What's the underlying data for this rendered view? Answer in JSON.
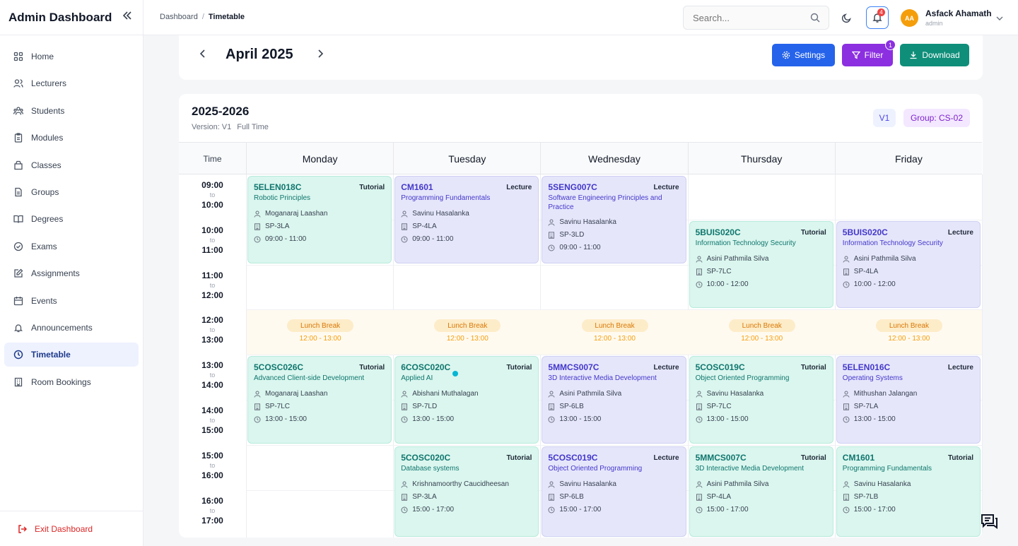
{
  "sidebar": {
    "title": "Admin Dashboard",
    "items": [
      {
        "label": "Home",
        "icon": "grid-icon"
      },
      {
        "label": "Lecturers",
        "icon": "users-icon"
      },
      {
        "label": "Students",
        "icon": "students-icon"
      },
      {
        "label": "Modules",
        "icon": "clipboard-icon"
      },
      {
        "label": "Classes",
        "icon": "classes-icon"
      },
      {
        "label": "Groups",
        "icon": "file-icon"
      },
      {
        "label": "Degrees",
        "icon": "book-icon"
      },
      {
        "label": "Exams",
        "icon": "check-circle-icon"
      },
      {
        "label": "Assignments",
        "icon": "edit-icon"
      },
      {
        "label": "Events",
        "icon": "calendar-icon"
      },
      {
        "label": "Announcements",
        "icon": "bell-icon"
      },
      {
        "label": "Timetable",
        "icon": "clock-icon"
      },
      {
        "label": "Room Bookings",
        "icon": "building-icon"
      }
    ],
    "active": "Timetable",
    "exit_label": "Exit Dashboard"
  },
  "header": {
    "breadcrumb": [
      "Dashboard",
      "Timetable"
    ],
    "search_placeholder": "Search...",
    "notification_count": "4",
    "user": {
      "initials": "AA",
      "name": "Asfack Ahamath",
      "role": "admin"
    }
  },
  "month": {
    "title": "April 2025",
    "settings_label": "Settings",
    "filter_label": "Filter",
    "filter_count": "1",
    "download_label": "Download"
  },
  "timetable": {
    "year": "2025-2026",
    "version": "Version: V1",
    "mode": "Full Time",
    "version_tag": "V1",
    "group_tag": "Group: CS-02",
    "time_header": "Time",
    "days": [
      "Monday",
      "Tuesday",
      "Wednesday",
      "Thursday",
      "Friday"
    ],
    "slots": [
      {
        "start": "09:00",
        "to": "to",
        "end": "10:00"
      },
      {
        "start": "10:00",
        "to": "to",
        "end": "11:00"
      },
      {
        "start": "11:00",
        "to": "to",
        "end": "12:00"
      },
      {
        "start": "12:00",
        "to": "to",
        "end": "13:00"
      },
      {
        "start": "13:00",
        "to": "to",
        "end": "14:00"
      },
      {
        "start": "14:00",
        "to": "to",
        "end": "15:00"
      },
      {
        "start": "15:00",
        "to": "to",
        "end": "16:00"
      },
      {
        "start": "16:00",
        "to": "to",
        "end": "17:00"
      }
    ],
    "lunch": {
      "label": "Lunch Break",
      "time": "12:00 - 13:00"
    },
    "events": [
      {
        "day": 0,
        "slot": 0,
        "span": 2,
        "code": "5ELEN018C",
        "kind": "Tutorial",
        "name": "Robotic Principles",
        "lecturer": "Moganaraj Laashan",
        "room": "SP-3LA",
        "time": "09:00 - 11:00"
      },
      {
        "day": 1,
        "slot": 0,
        "span": 2,
        "code": "CM1601",
        "kind": "Lecture",
        "name": "Programming Fundamentals",
        "lecturer": "Savinu Hasalanka",
        "room": "SP-4LA",
        "time": "09:00 - 11:00"
      },
      {
        "day": 2,
        "slot": 0,
        "span": 2,
        "code": "5SENG007C",
        "kind": "Lecture",
        "name": "Software Engineering Principles and Practice",
        "lecturer": "Savinu Hasalanka",
        "room": "SP-3LD",
        "time": "09:00 - 11:00"
      },
      {
        "day": 3,
        "slot": 1,
        "span": 2,
        "code": "5BUIS020C",
        "kind": "Tutorial",
        "name": "Information Technology Security",
        "lecturer": "Asini Pathmila Silva",
        "room": "SP-7LC",
        "time": "10:00 - 12:00"
      },
      {
        "day": 4,
        "slot": 1,
        "span": 2,
        "code": "5BUIS020C",
        "kind": "Lecture",
        "name": "Information Technology Security",
        "lecturer": "Asini Pathmila Silva",
        "room": "SP-4LA",
        "time": "10:00 - 12:00"
      },
      {
        "day": 0,
        "slot": 4,
        "span": 2,
        "code": "5COSC026C",
        "kind": "Tutorial",
        "name": "Advanced Client-side Development",
        "lecturer": "Moganaraj Laashan",
        "room": "SP-7LC",
        "time": "13:00 - 15:00"
      },
      {
        "day": 1,
        "slot": 4,
        "span": 2,
        "code": "6COSC020C",
        "kind": "Tutorial",
        "name": "Applied AI",
        "lecturer": "Abishani Muthalagan",
        "room": "SP-7LD",
        "time": "13:00 - 15:00"
      },
      {
        "day": 2,
        "slot": 4,
        "span": 2,
        "code": "5MMCS007C",
        "kind": "Lecture",
        "name": "3D Interactive Media Development",
        "lecturer": "Asini Pathmila Silva",
        "room": "SP-6LB",
        "time": "13:00 - 15:00"
      },
      {
        "day": 3,
        "slot": 4,
        "span": 2,
        "code": "5COSC019C",
        "kind": "Tutorial",
        "name": "Object Oriented Programming",
        "lecturer": "Savinu Hasalanka",
        "room": "SP-7LC",
        "time": "13:00 - 15:00"
      },
      {
        "day": 4,
        "slot": 4,
        "span": 2,
        "code": "5ELEN016C",
        "kind": "Lecture",
        "name": "Operating Systems",
        "lecturer": "Mithushan Jalangan",
        "room": "SP-7LA",
        "time": "13:00 - 15:00"
      },
      {
        "day": 1,
        "slot": 6,
        "span": 2,
        "code": "5COSC020C",
        "kind": "Tutorial",
        "name": "Database systems",
        "lecturer": "Krishnamoorthy Caucidheesan",
        "room": "SP-3LA",
        "time": "15:00 - 17:00"
      },
      {
        "day": 2,
        "slot": 6,
        "span": 2,
        "code": "5COSC019C",
        "kind": "Lecture",
        "name": "Object Oriented Programming",
        "lecturer": "Savinu Hasalanka",
        "room": "SP-6LB",
        "time": "15:00 - 17:00"
      },
      {
        "day": 3,
        "slot": 6,
        "span": 2,
        "code": "5MMCS007C",
        "kind": "Tutorial",
        "name": "3D Interactive Media Development",
        "lecturer": "Asini Pathmila Silva",
        "room": "SP-4LA",
        "time": "15:00 - 17:00"
      },
      {
        "day": 4,
        "slot": 6,
        "span": 2,
        "code": "CM1601",
        "kind": "Tutorial",
        "name": "Programming Fundamentals",
        "lecturer": "Savinu Hasalanka",
        "room": "SP-7LB",
        "time": "15:00 - 17:00"
      }
    ]
  },
  "colors": {
    "primary": "#2563eb",
    "filter": "#8b2fe0",
    "download": "#0f8f7a",
    "tutorial_bg": "#daf6ee",
    "lecture_bg": "#e6e6fb",
    "lunch_text": "#d97706",
    "exit": "#dc2626"
  }
}
